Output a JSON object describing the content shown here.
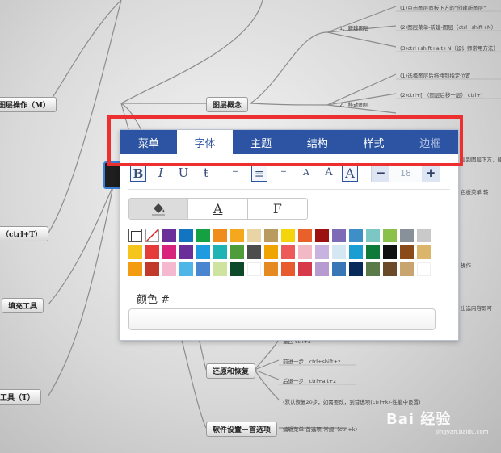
{
  "mindmap": {
    "left_nodes": [
      "图层操作（M）",
      "（ctrl+T）",
      "填充工具",
      "工具（T）"
    ],
    "center_nodes": [
      "图层概念",
      "还原和恢复",
      "软件设置－首选项"
    ],
    "leaves": [
      "(1)点击图层面板下方的\"创建新图层\"",
      "(2)图层菜单-新建-图层（ctrl+shift+N）",
      "(3)ctrl+shift+alt+N（设计师常用方法）",
      "1．新建图层",
      "(1)选择图层后拖拽到指定位置",
      "(2)ctrl+[  （图层后移一层）  ctrl+]",
      "2．移动图层",
      "撤回  ctrl+z",
      "前进一步，ctrl+shift+z",
      "后退一步，ctrl+alt+z",
      "(默认恢复20步，如需要改，到首选项(ctrl+k)-性能中设置)",
      "编辑菜单-首选项-常规（ctrl+k）",
      "层到图层下方，能中",
      "色板菜单 转",
      "操作",
      "出选内容即可"
    ]
  },
  "panel": {
    "tabs": [
      "菜单",
      "字体",
      "主题",
      "结构",
      "样式",
      "边框"
    ],
    "active_tab": "字体",
    "format_buttons": [
      "B",
      "I",
      "U",
      "ŧ",
      "⁼",
      "≡",
      "⁼",
      "A",
      "A",
      "A"
    ],
    "font_size": "18",
    "decrement": "−",
    "increment": "+",
    "segments": [
      "fill-bucket-icon",
      "A",
      "F"
    ],
    "color_label": "颜色 #",
    "color_value": ""
  },
  "palette": {
    "rows": [
      [
        "none",
        "none-slash",
        "#6b2f9a",
        "#1374c0",
        "#15a043",
        "#f08c1c",
        "#f6a81c",
        "#e9d4a6",
        "#b99a5f",
        "#f4d40a",
        "#e8612b",
        "#9b1010",
        "#7d6bb5",
        "#3e8ec7",
        "#7ac7c4",
        "#8bc14a",
        "#889099",
        "#c9c9c9"
      ],
      [
        "#f6c51c",
        "#e63b3b",
        "#d9227c",
        "#6b2f9a",
        "#1f9be0",
        "#1fb3b3",
        "#4e9c3a",
        "#4d4d4d",
        "#f0a400",
        "#ec5a5a",
        "#f2b8c6",
        "#c7b3dd",
        "#d4e7f2",
        "#1a9dd1",
        "#0e7a3a",
        "#111111",
        "#8a4a1a",
        "#dbb66a"
      ],
      [
        "#f39c12",
        "#c0392b",
        "#f4b8cf",
        "#4fb7e8",
        "#4a86cf",
        "#cfe3a0",
        "#0c4a2a",
        "#ffffff",
        "#e58a20",
        "#e85b2e",
        "#d63a4a",
        "#b79bd0",
        "#3976b6",
        "#082a5a",
        "#5b7a4a",
        "#6b4a2a",
        "#c8a46e",
        "#ffffff"
      ]
    ]
  },
  "watermark": {
    "brand": "Bai 经验",
    "url": "jingyan.baidu.com"
  }
}
